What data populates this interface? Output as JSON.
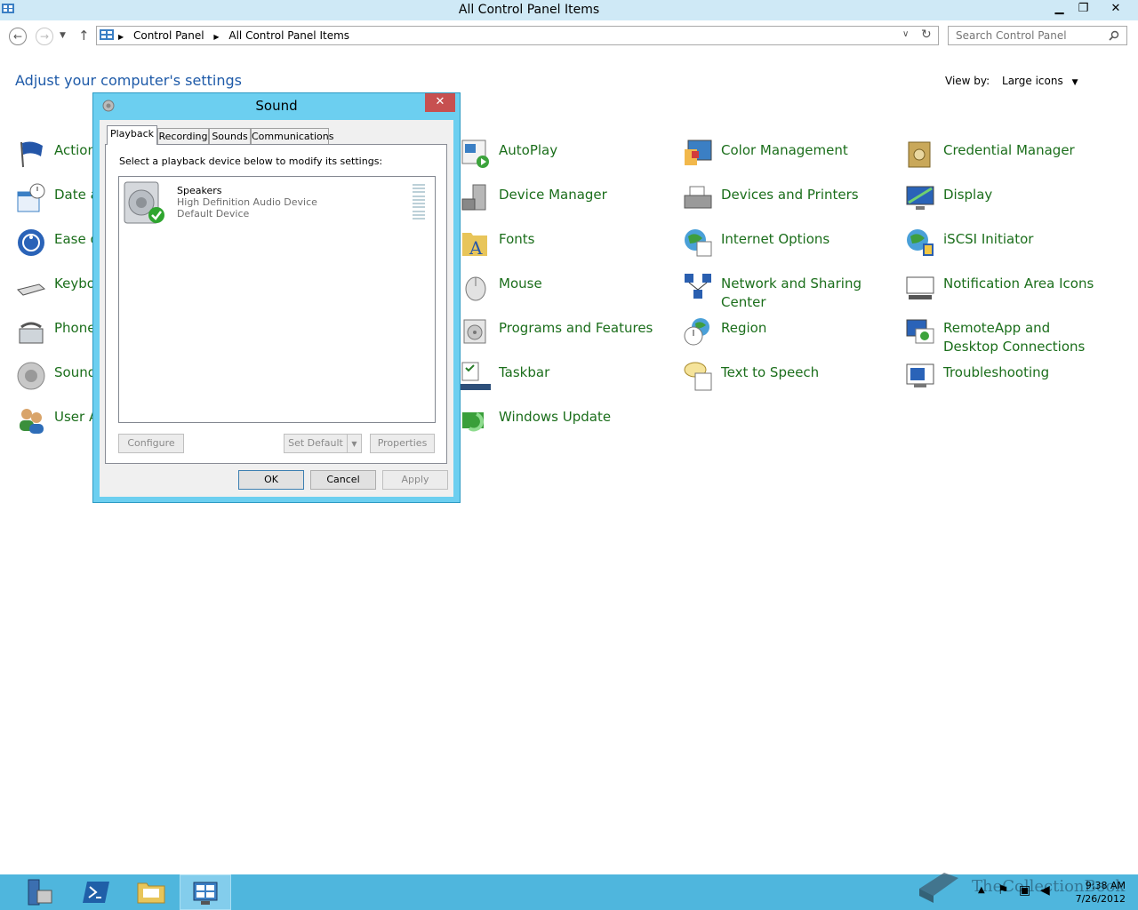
{
  "window": {
    "title": "All Control Panel Items"
  },
  "address": {
    "crumbs": [
      "Control Panel",
      "All Control Panel Items"
    ]
  },
  "search": {
    "placeholder": "Search Control Panel"
  },
  "content": {
    "heading": "Adjust your computer's settings",
    "view_by_label": "View by:",
    "view_by_value": "Large icons"
  },
  "items_col1_partial": [
    "Action",
    "Date a",
    "Ease o",
    "Keybo",
    "Phone",
    "Sound",
    "User A"
  ],
  "items_col2": [
    "AutoPlay",
    "Device Manager",
    "Fonts",
    "Mouse",
    "Programs and Features",
    "Taskbar",
    "Windows Update"
  ],
  "items_col3": [
    "Color Management",
    "Devices and Printers",
    "Internet Options",
    "Network and Sharing Center",
    "Region",
    "Text to Speech"
  ],
  "items_col4": [
    "Credential Manager",
    "Display",
    "iSCSI Initiator",
    "Notification Area Icons",
    "RemoteApp and Desktop Connections",
    "Troubleshooting"
  ],
  "dialog": {
    "title": "Sound",
    "tabs": [
      "Playback",
      "Recording",
      "Sounds",
      "Communications"
    ],
    "prompt": "Select a playback device below to modify its settings:",
    "device": {
      "name": "Speakers",
      "description": "High Definition Audio Device",
      "status": "Default Device"
    },
    "buttons": {
      "configure": "Configure",
      "set_default": "Set Default",
      "properties": "Properties",
      "ok": "OK",
      "cancel": "Cancel",
      "apply": "Apply"
    }
  },
  "taskbar": {
    "watermark": "TheCollectionBook",
    "time": "9:38 AM",
    "date": "7/26/2012"
  },
  "colors": {
    "link": "#1b6e1b",
    "heading": "#1e5aa8",
    "titlebar": "#cfe9f6",
    "dialog_frame": "#6ccff0",
    "taskbar": "#4fb6dd"
  }
}
